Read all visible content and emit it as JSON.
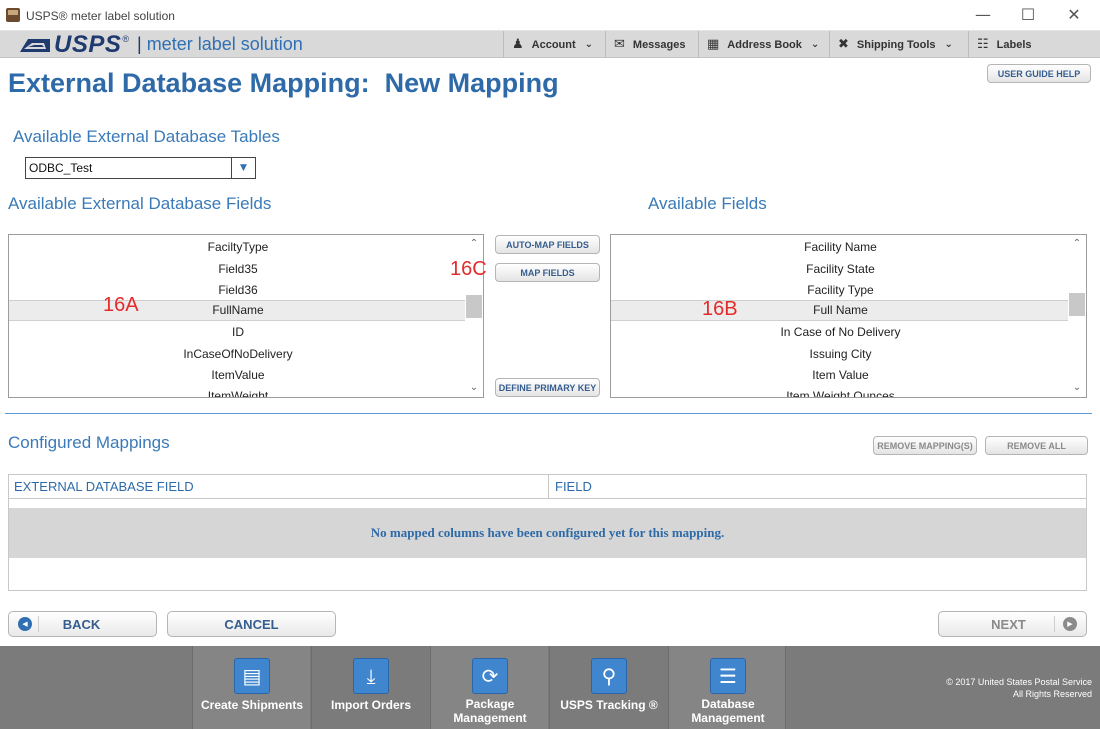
{
  "window": {
    "title": "USPS® meter label solution",
    "minimize": "—",
    "maximize": "☐",
    "close": "✕"
  },
  "nav": {
    "brand": "USPS",
    "brand_reg": "®",
    "product": "meter label solution",
    "items": [
      {
        "label": "Account",
        "icon": "person-icon",
        "has_dropdown": true
      },
      {
        "label": "Messages",
        "icon": "envelope-icon",
        "has_dropdown": false
      },
      {
        "label": "Address Book",
        "icon": "address-book-icon",
        "has_dropdown": true
      },
      {
        "label": "Shipping Tools",
        "icon": "tools-icon",
        "has_dropdown": true
      },
      {
        "label": "Labels",
        "icon": "cart-icon",
        "has_dropdown": false
      }
    ]
  },
  "page": {
    "title": "External Database Mapping:  New Mapping",
    "user_guide_label": "USER GUIDE HELP"
  },
  "tables_section": {
    "label": "Available External Database Tables",
    "selected_table": "ODBC_Test"
  },
  "external_fields": {
    "label": "Available External Database Fields",
    "items": [
      "FaciltyType",
      "Field35",
      "Field36",
      "FullName",
      "ID",
      "InCaseOfNoDelivery",
      "ItemValue",
      "ItemWeight"
    ],
    "selected": "FullName",
    "marker": "16A"
  },
  "available_fields": {
    "label": "Available Fields",
    "items": [
      "Facility Name",
      "Facility State",
      "Facility Type",
      "Full Name",
      "In Case of No Delivery",
      "Issuing City",
      "Item Value",
      "Item Weight Ounces"
    ],
    "selected": "Full Name",
    "marker": "16B"
  },
  "actions": {
    "auto_map": "AUTO-MAP FIELDS",
    "map_fields": "MAP FIELDS",
    "define_primary_key": "DEFINE PRIMARY KEY",
    "marker": "16C"
  },
  "configured": {
    "label": "Configured Mappings",
    "remove_mappings": "REMOVE MAPPING(S)",
    "remove_all": "REMOVE ALL",
    "columns": [
      "EXTERNAL DATABASE FIELD",
      "FIELD"
    ],
    "empty_message": "No mapped columns have been configured yet for this mapping."
  },
  "footer_buttons": {
    "back": "BACK",
    "cancel": "CANCEL",
    "next": "NEXT"
  },
  "footer": {
    "tiles": [
      {
        "label": "Create Shipments",
        "icon": "label-icon"
      },
      {
        "label": "Import Orders",
        "icon": "import-icon"
      },
      {
        "label": "Package Management",
        "icon": "refresh-icon"
      },
      {
        "label": "USPS Tracking ®",
        "icon": "tracking-icon"
      },
      {
        "label": "Database Management",
        "icon": "database-icon"
      }
    ],
    "copyright_line1": "© 2017 United States Postal Service",
    "copyright_line2": "All Rights Reserved"
  },
  "colors": {
    "heading_blue": "#2e6aa8",
    "marker_red": "#e32b2b",
    "footer_gray": "#7b7b7b"
  }
}
